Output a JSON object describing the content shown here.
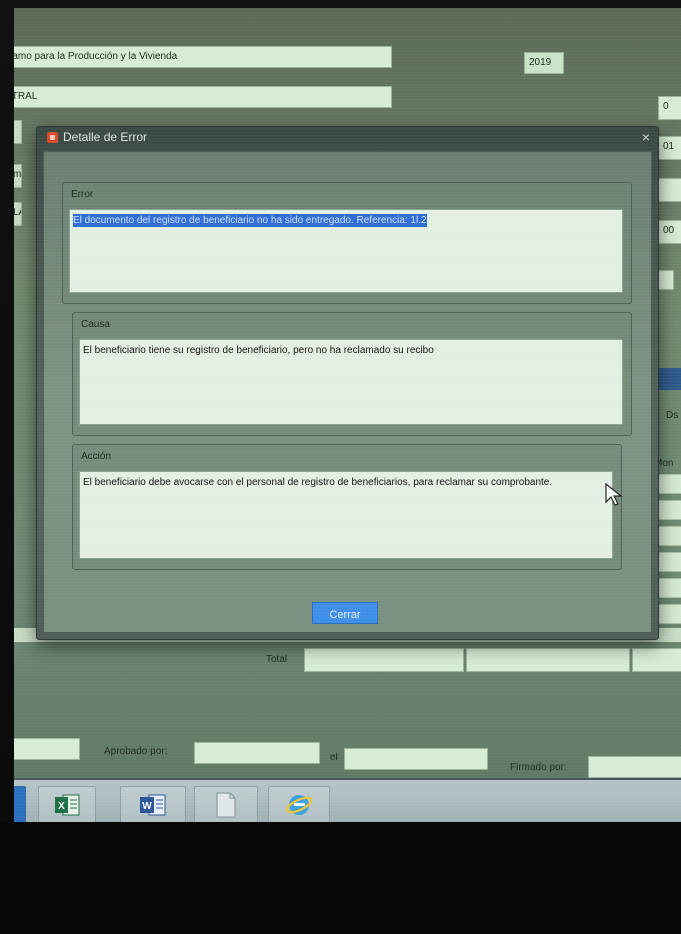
{
  "background_app": {
    "program_name": "ramo para la Producción y la Vivienda",
    "year": "2019",
    "region": "ITRAL",
    "right_fields": [
      "0",
      "01",
      "",
      "00"
    ],
    "left_fragments": [
      "",
      "m",
      "LA"
    ],
    "column_fragments": [
      "Ds",
      "Mon"
    ],
    "total_label": "Total",
    "approved_by_label": "Aprobado por:",
    "on_label": "el",
    "signed_by_label": "Firmado por:"
  },
  "dialog": {
    "title": "Detalle de Error",
    "close_glyph": "×",
    "sections": [
      {
        "label": "Error",
        "text": "El documento del registro de beneficiario no ha sido entregado. Referencia: 1l.2",
        "selected": true
      },
      {
        "label": "Causa",
        "text": "El beneficiario tiene su registro de beneficiario, pero no ha reclamado su recibo",
        "selected": false
      },
      {
        "label": "Acción",
        "text": "El beneficiario debe avocarse con el personal de registro de beneficiarios, para reclamar su comprobante.",
        "selected": false
      }
    ],
    "button_label": "Cerrar"
  },
  "taskbar": {
    "items": [
      "excel-icon",
      "word-icon",
      "document-icon",
      "internet-explorer-icon"
    ]
  },
  "colors": {
    "accent_button": "#3f8ee8",
    "selection": "#2f6ed6",
    "field_bg": "#d7ecd4"
  }
}
